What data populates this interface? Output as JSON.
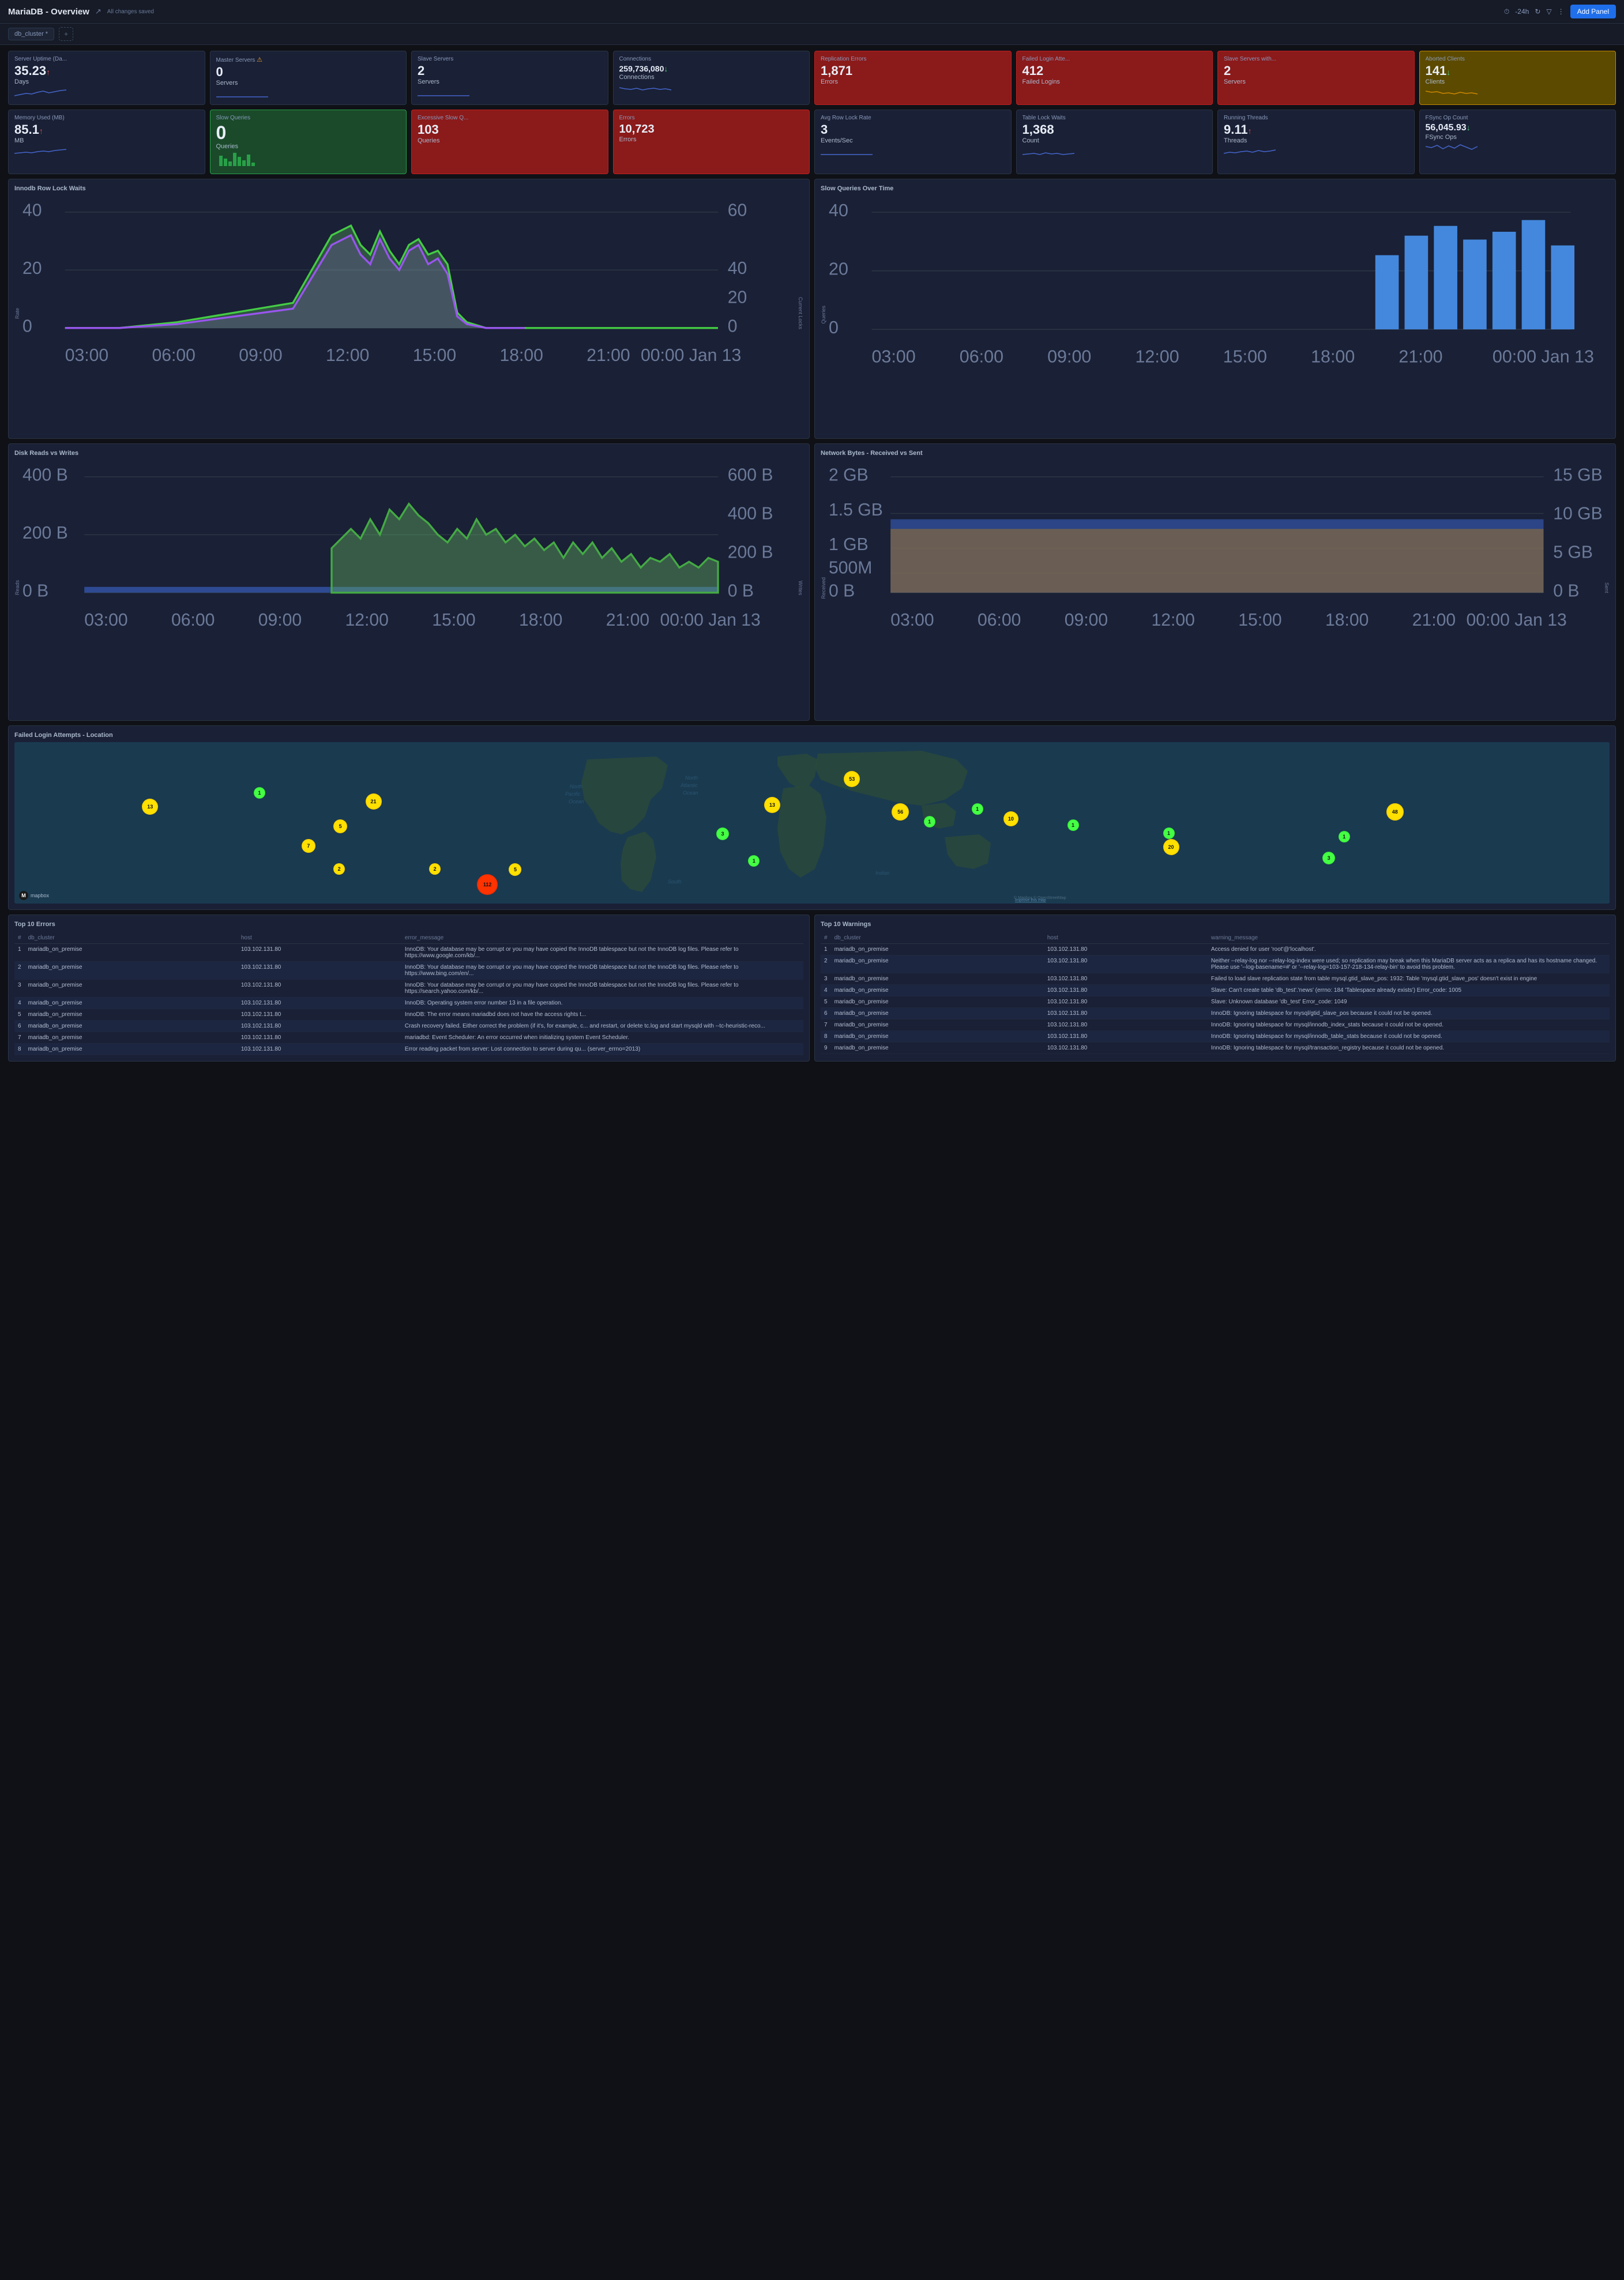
{
  "header": {
    "title": "MariaDB - Overview",
    "save_status": "All changes saved",
    "time_range": "-24h",
    "add_panel_label": "Add Panel"
  },
  "tabs": [
    {
      "label": "db_cluster *"
    }
  ],
  "stats_row1": [
    {
      "id": "server-uptime",
      "title": "Server Uptime (Da...",
      "value": "35.23",
      "arrow": "up",
      "unit": "Days",
      "variant": "normal"
    },
    {
      "id": "master-servers",
      "title": "Master Servers",
      "value": "0",
      "arrow": "",
      "unit": "Servers",
      "variant": "normal",
      "warning": true
    },
    {
      "id": "slave-servers",
      "title": "Slave Servers",
      "value": "2",
      "arrow": "",
      "unit": "Servers",
      "variant": "normal"
    },
    {
      "id": "connections",
      "title": "Connections",
      "value": "259,736,080",
      "arrow": "down",
      "unit": "Connections",
      "variant": "normal"
    },
    {
      "id": "replication-errors",
      "title": "Replication Errors",
      "value": "1,871",
      "arrow": "",
      "unit": "Errors",
      "variant": "red"
    },
    {
      "id": "failed-logins",
      "title": "Failed Login Atte...",
      "value": "412",
      "arrow": "",
      "unit": "Failed Logins",
      "variant": "red"
    },
    {
      "id": "slave-servers-with",
      "title": "Slave Servers with...",
      "value": "2",
      "arrow": "",
      "unit": "Servers",
      "variant": "red"
    },
    {
      "id": "aborted-clients",
      "title": "Aborted Clients",
      "value": "141",
      "arrow": "down",
      "unit": "Clients",
      "variant": "yellow"
    }
  ],
  "stats_row2": [
    {
      "id": "memory-used",
      "title": "Memory Used (MB)",
      "value": "85.1",
      "arrow": "up",
      "unit": "MB",
      "variant": "normal"
    },
    {
      "id": "slow-queries",
      "title": "Slow Queries",
      "value": "0",
      "arrow": "",
      "unit": "Queries",
      "variant": "green"
    },
    {
      "id": "excessive-slow",
      "title": "Excessive Slow Q...",
      "value": "103",
      "arrow": "",
      "unit": "Queries",
      "variant": "red"
    },
    {
      "id": "errors",
      "title": "Errors",
      "value": "10,723",
      "arrow": "",
      "unit": "Errors",
      "variant": "red"
    },
    {
      "id": "avg-row-lock",
      "title": "Avg Row Lock Rate",
      "value": "3",
      "arrow": "",
      "unit": "Events/Sec",
      "variant": "normal"
    },
    {
      "id": "table-lock-waits",
      "title": "Table Lock Waits",
      "value": "1,368",
      "arrow": "",
      "unit": "Count",
      "variant": "normal"
    },
    {
      "id": "running-threads",
      "title": "Running Threads",
      "value": "9.11",
      "arrow": "up",
      "unit": "Threads",
      "variant": "normal"
    },
    {
      "id": "fsync-op-count",
      "title": "FSync Op Count",
      "value": "56,045.93",
      "arrow": "down",
      "unit": "FSync Ops",
      "variant": "normal"
    }
  ],
  "charts": {
    "innodb_row_lock": {
      "title": "Innodb Row Lock Waits",
      "y_label_left": "Rate",
      "y_label_right": "Current Locks",
      "x_labels": [
        "03:00",
        "06:00",
        "09:00",
        "12:00",
        "15:00",
        "18:00",
        "21:00",
        "00:00 Jan 13"
      ],
      "y_max_left": 40,
      "y_max_right": 60
    },
    "slow_queries_time": {
      "title": "Slow Queries Over Time",
      "y_label": "Queries",
      "x_labels": [
        "03:00",
        "06:00",
        "09:00",
        "12:00",
        "15:00",
        "18:00",
        "21:00",
        "00:00 Jan 13"
      ],
      "y_max": 40
    },
    "disk_reads_writes": {
      "title": "Disk Reads vs Writes",
      "y_label_left": "Reads",
      "y_label_right": "Writes",
      "x_labels": [
        "03:00",
        "06:00",
        "09:00",
        "12:00",
        "15:00",
        "18:00",
        "21:00",
        "00:00 Jan 13"
      ],
      "y_left_labels": [
        "400 B",
        "200 B",
        "0 B"
      ],
      "y_right_labels": [
        "600 B",
        "400 B",
        "200 B",
        "0 B"
      ]
    },
    "network_bytes": {
      "title": "Network Bytes - Received vs Sent",
      "y_label_left": "Received",
      "y_label_right": "Sent",
      "x_labels": [
        "03:00",
        "06:00",
        "09:00",
        "12:00",
        "15:00",
        "18:00",
        "21:00",
        "00:00 Jan 13"
      ],
      "y_left_labels": [
        "2 GB",
        "1.5 GB",
        "1 GB",
        "500 MB",
        "0 B"
      ],
      "y_right_labels": [
        "15 GB",
        "10 GB",
        "5 GB",
        "0 B"
      ]
    }
  },
  "map": {
    "title": "Failed Login Attempts - Location",
    "locations": [
      {
        "label": "13",
        "size": 28,
        "top": "35%",
        "left": "8%",
        "variant": "yellow"
      },
      {
        "label": "1",
        "size": 20,
        "top": "28%",
        "left": "15%",
        "variant": "green"
      },
      {
        "label": "21",
        "size": 28,
        "top": "32%",
        "left": "22%",
        "variant": "yellow"
      },
      {
        "label": "5",
        "size": 24,
        "top": "48%",
        "left": "20%",
        "variant": "yellow"
      },
      {
        "label": "7",
        "size": 24,
        "top": "60%",
        "left": "18%",
        "variant": "yellow"
      },
      {
        "label": "2",
        "size": 20,
        "top": "75%",
        "left": "20%",
        "variant": "yellow"
      },
      {
        "label": "2",
        "size": 20,
        "top": "75%",
        "left": "26%",
        "variant": "yellow"
      },
      {
        "label": "5",
        "size": 22,
        "top": "75%",
        "left": "31%",
        "variant": "yellow"
      },
      {
        "label": "112",
        "size": 36,
        "top": "82%",
        "left": "29%",
        "variant": "red"
      },
      {
        "label": "53",
        "size": 28,
        "top": "18%",
        "left": "52%",
        "variant": "yellow"
      },
      {
        "label": "13",
        "size": 28,
        "top": "34%",
        "left": "47%",
        "variant": "yellow"
      },
      {
        "label": "3",
        "size": 22,
        "top": "53%",
        "left": "44%",
        "variant": "green"
      },
      {
        "label": "56",
        "size": 30,
        "top": "38%",
        "left": "55%",
        "variant": "yellow"
      },
      {
        "label": "1",
        "size": 20,
        "top": "38%",
        "left": "60%",
        "variant": "green"
      },
      {
        "label": "10",
        "size": 26,
        "top": "43%",
        "left": "62%",
        "variant": "yellow"
      },
      {
        "label": "1",
        "size": 20,
        "top": "46%",
        "left": "57%",
        "variant": "green"
      },
      {
        "label": "1",
        "size": 20,
        "top": "48%",
        "left": "66%",
        "variant": "green"
      },
      {
        "label": "1",
        "size": 20,
        "top": "53%",
        "left": "72%",
        "variant": "green"
      },
      {
        "label": "20",
        "size": 28,
        "top": "60%",
        "left": "72%",
        "variant": "yellow"
      },
      {
        "label": "48",
        "size": 30,
        "top": "38%",
        "left": "86%",
        "variant": "yellow"
      },
      {
        "label": "1",
        "size": 20,
        "top": "55%",
        "left": "83%",
        "variant": "green"
      },
      {
        "label": "3",
        "size": 22,
        "top": "68%",
        "left": "82%",
        "variant": "green"
      },
      {
        "label": "1",
        "size": 20,
        "top": "70%",
        "left": "46%",
        "variant": "green"
      }
    ]
  },
  "errors_table": {
    "title": "Top 10 Errors",
    "columns": [
      "#",
      "db_cluster",
      "host",
      "error_message"
    ],
    "rows": [
      {
        "num": 1,
        "cluster": "mariadb_on_premise",
        "host": "103.102.131.80",
        "message": "InnoDB: Your database may be corrupt or you may have copied the InnoDB tablespace but not the InnoDB log files. Please refer to https://www.google.com/kb/..."
      },
      {
        "num": 2,
        "cluster": "mariadb_on_premise",
        "host": "103.102.131.80",
        "message": "InnoDB: Your database may be corrupt or you may have copied the InnoDB tablespace but not the InnoDB log files. Please refer to https://www.bing.com/en/..."
      },
      {
        "num": 3,
        "cluster": "mariadb_on_premise",
        "host": "103.102.131.80",
        "message": "InnoDB: Your database may be corrupt or you may have copied the InnoDB tablespace but not the InnoDB log files. Please refer to https://search.yahoo.com/kb/..."
      },
      {
        "num": 4,
        "cluster": "mariadb_on_premise",
        "host": "103.102.131.80",
        "message": "InnoDB: Operating system error number 13 in a file operation."
      },
      {
        "num": 5,
        "cluster": "mariadb_on_premise",
        "host": "103.102.131.80",
        "message": "InnoDB: The error means mariadbd does not have the access rights t..."
      },
      {
        "num": 6,
        "cluster": "mariadb_on_premise",
        "host": "103.102.131.80",
        "message": "Crash recovery failed. Either correct the problem (if it's, for example, c... and restart, or delete tc.log and start mysqld with --tc-heuristic-reco..."
      },
      {
        "num": 7,
        "cluster": "mariadb_on_premise",
        "host": "103.102.131.80",
        "message": "mariadbd: Event Scheduler: An error occurred when initializing system Event Scheduler."
      },
      {
        "num": 8,
        "cluster": "mariadb_on_premise",
        "host": "103.102.131.80",
        "message": "Error reading packet from server: Lost connection to server during qu... (server_errno=2013)"
      }
    ]
  },
  "warnings_table": {
    "title": "Top 10 Warnings",
    "columns": [
      "#",
      "db_cluster",
      "host",
      "warning_message"
    ],
    "rows": [
      {
        "num": 1,
        "cluster": "mariadb_on_premise",
        "host": "103.102.131.80",
        "message": "Access denied for user 'root'@'localhost'."
      },
      {
        "num": 2,
        "cluster": "mariadb_on_premise",
        "host": "103.102.131.80",
        "message": "Neither --relay-log nor --relay-log-index were used; so replication may break when this MariaDB server acts as a replica and has its hostname changed. Please use '--log-basename=#' or '--relay-log=103-157-218-134-relay-bin' to avoid this problem."
      },
      {
        "num": 3,
        "cluster": "mariadb_on_premise",
        "host": "103.102.131.80",
        "message": "Failed to load slave replication state from table mysql.gtid_slave_pos: 1932: Table 'mysql.gtid_slave_pos' doesn't exist in engine"
      },
      {
        "num": 4,
        "cluster": "mariadb_on_premise",
        "host": "103.102.131.80",
        "message": "Slave: Can't create table 'db_test'.'news' (errno: 184 'Tablespace already exists') Error_code: 1005"
      },
      {
        "num": 5,
        "cluster": "mariadb_on_premise",
        "host": "103.102.131.80",
        "message": "Slave: Unknown database 'db_test' Error_code: 1049"
      },
      {
        "num": 6,
        "cluster": "mariadb_on_premise",
        "host": "103.102.131.80",
        "message": "InnoDB: Ignoring tablespace for mysql/gtid_slave_pos because it could not be opened."
      },
      {
        "num": 7,
        "cluster": "mariadb_on_premise",
        "host": "103.102.131.80",
        "message": "InnoDB: Ignoring tablespace for mysql/innodb_index_stats because it could not be opened."
      },
      {
        "num": 8,
        "cluster": "mariadb_on_premise",
        "host": "103.102.131.80",
        "message": "InnoDB: Ignoring tablespace for mysql/innodb_table_stats because it could not be opened."
      },
      {
        "num": 9,
        "cluster": "mariadb_on_premise",
        "host": "103.102.131.80",
        "message": "InnoDB: Ignoring tablespace for mysql/transaction_registry because it could not be opened."
      }
    ]
  }
}
